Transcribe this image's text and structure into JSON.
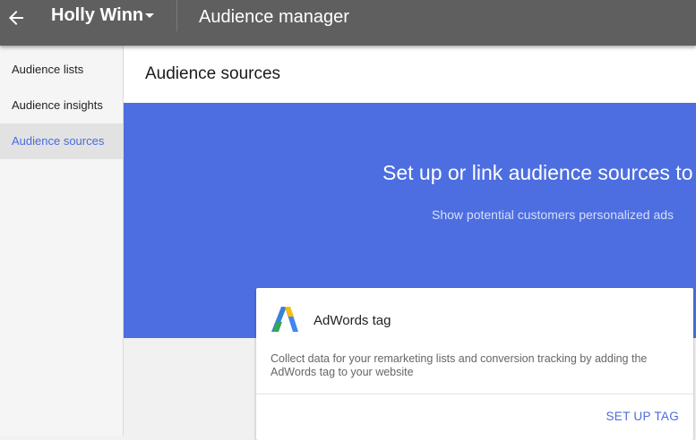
{
  "topbar": {
    "back_icon": "arrow-left-icon",
    "account_name": "Holly Winn",
    "account_dropdown_icon": "caret-down-icon",
    "app_title": "Audience manager"
  },
  "sidebar": {
    "items": [
      {
        "label": "Audience lists",
        "active": false
      },
      {
        "label": "Audience insights",
        "active": false
      },
      {
        "label": "Audience sources",
        "active": true
      }
    ]
  },
  "main": {
    "title": "Audience sources",
    "hero": {
      "title": "Set up or link audience sources to",
      "subtitle": "Show potential customers personalized ads"
    },
    "card": {
      "logo_icon": "adwords-logo-icon",
      "title": "AdWords tag",
      "description": "Collect data for your remarketing lists and conversion tracking by adding the AdWords tag to your website",
      "action_label": "SET UP TAG"
    }
  },
  "colors": {
    "topbar": "#5f5f5f",
    "hero": "#4d6ee0",
    "accent": "#4a6bdc"
  }
}
